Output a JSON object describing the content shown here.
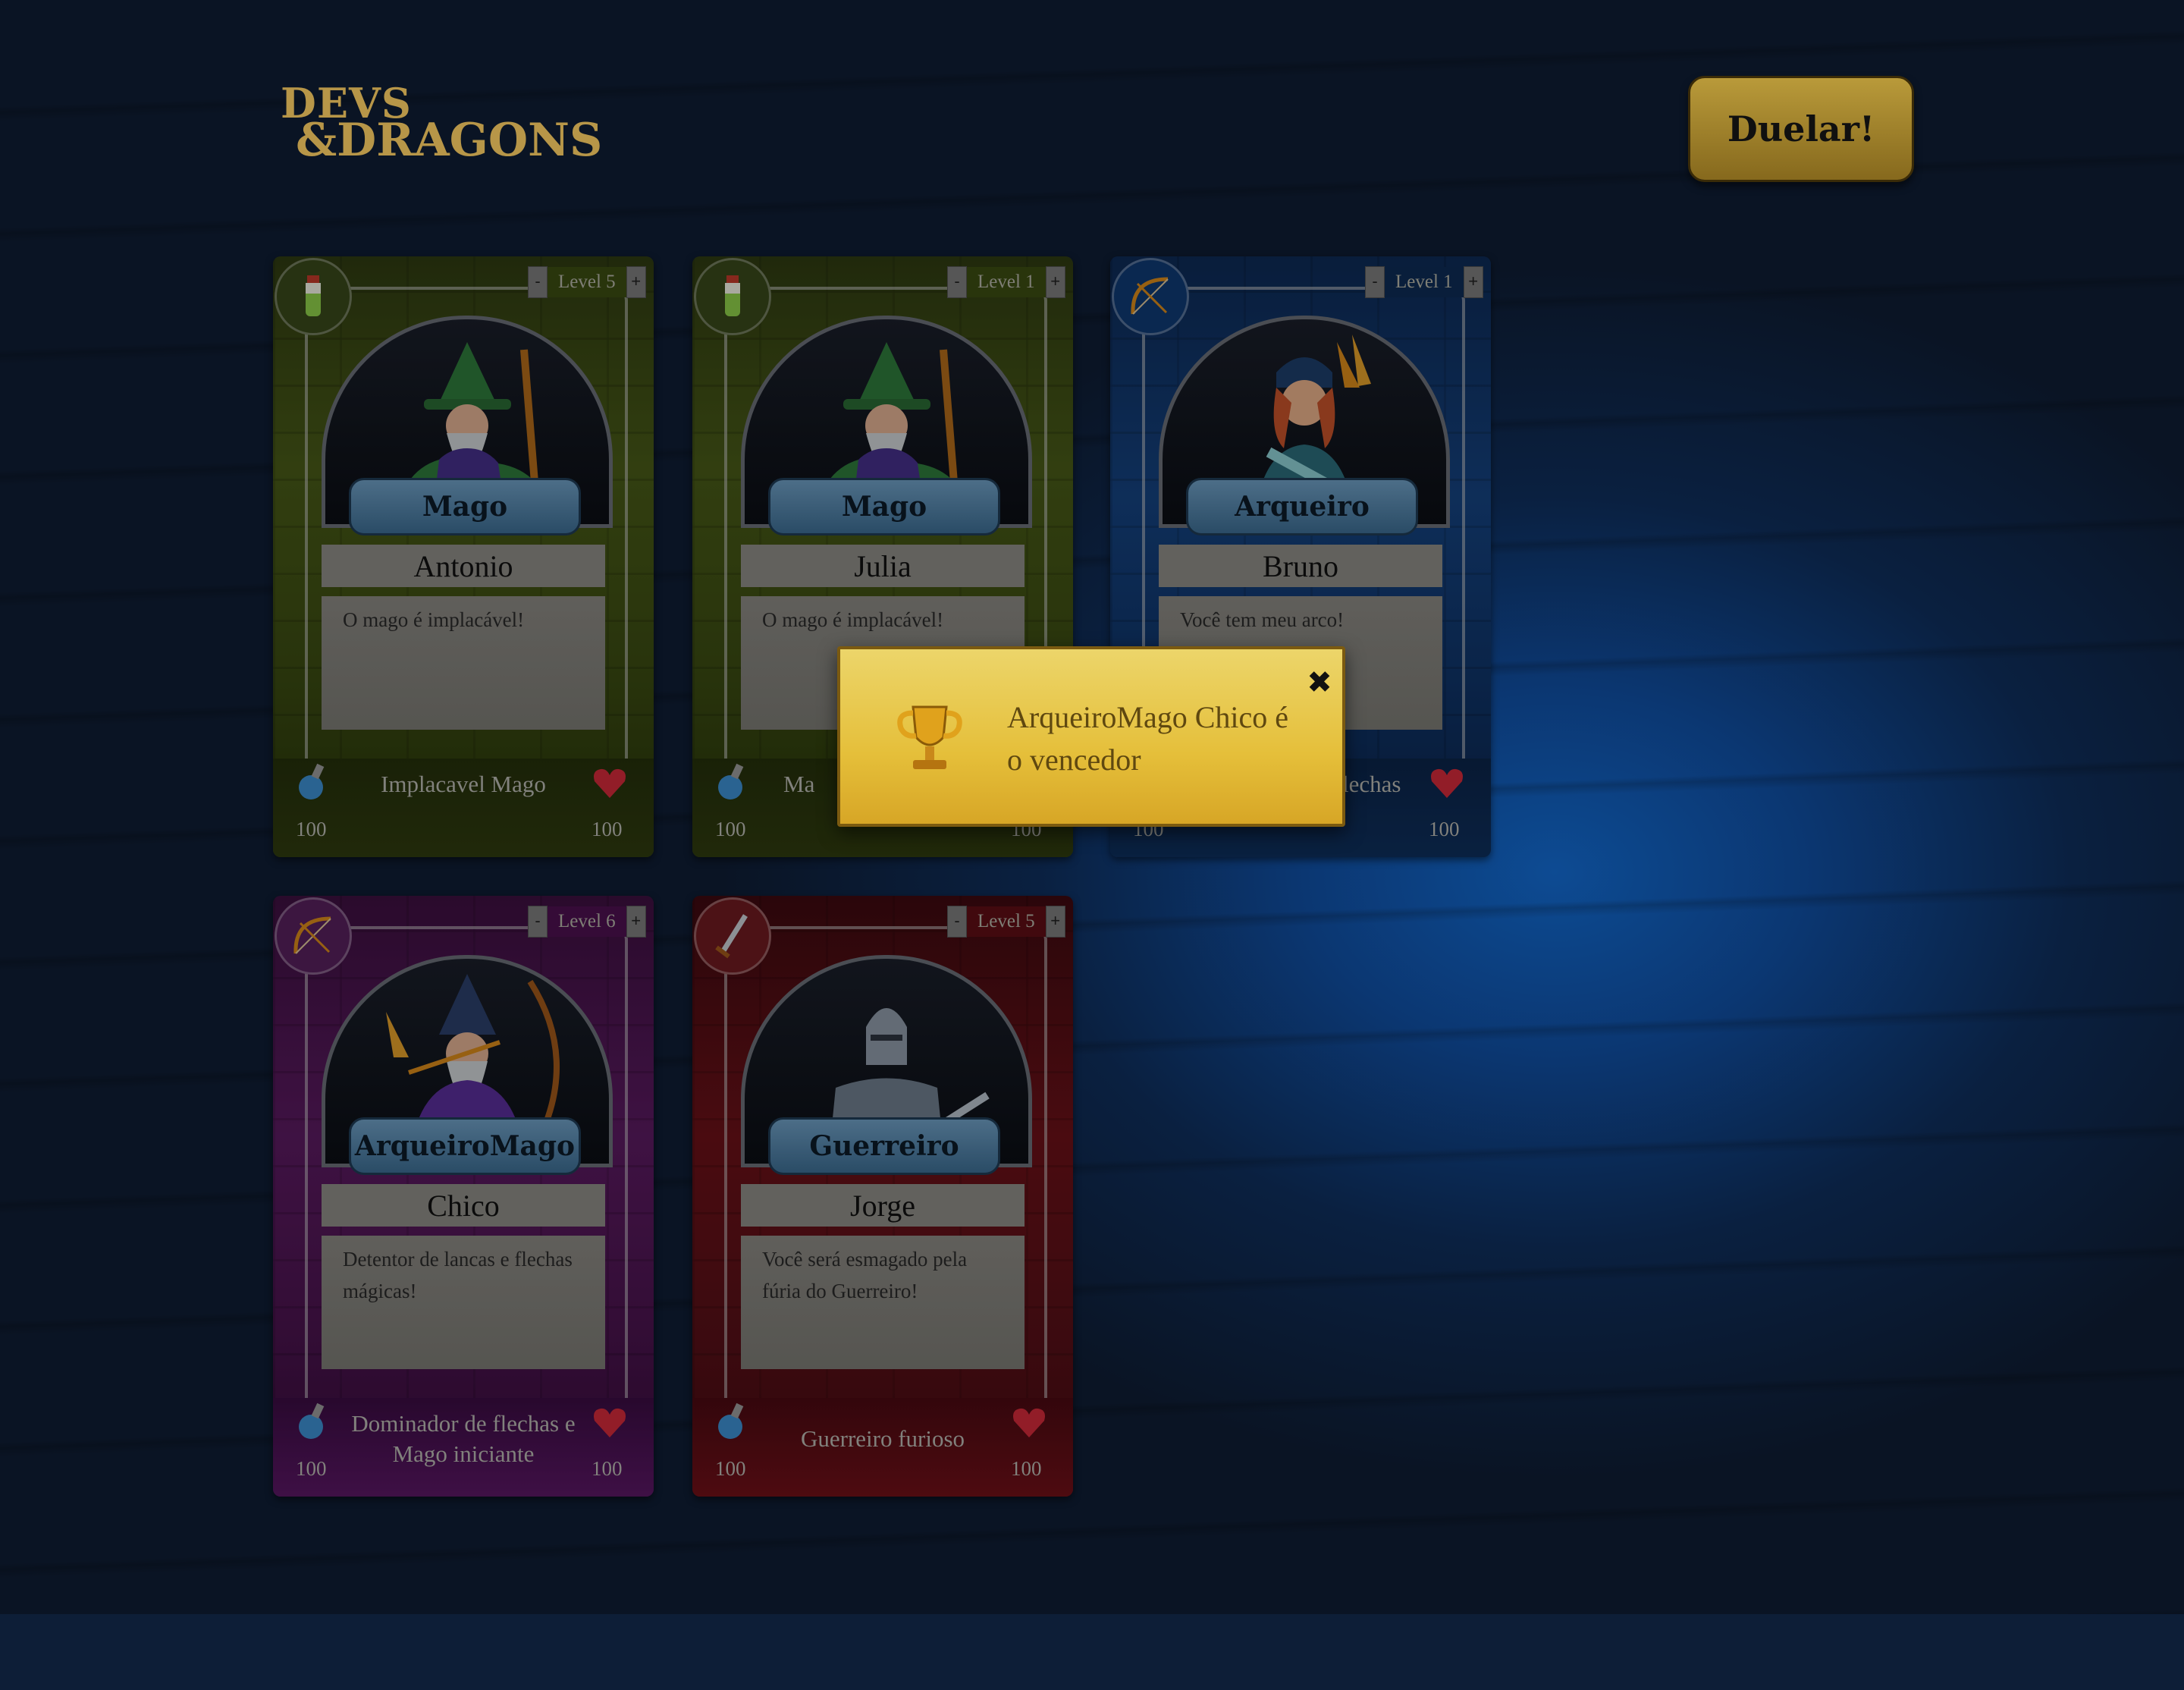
{
  "app": {
    "logo": {
      "line1": "DEVS",
      "line2": "&DRAGONS"
    },
    "duel_button": "Duelar!"
  },
  "cards": [
    {
      "theme": "green",
      "type_icon": "potion-icon",
      "level": "Level 5",
      "class": "Mago",
      "name": "Antonio",
      "description": "O mago é implacável!",
      "subtitle": "Implacavel Mago",
      "mana": "100",
      "hp": "100"
    },
    {
      "theme": "green",
      "type_icon": "potion-icon",
      "level": "Level 1",
      "class": "Mago",
      "name": "Julia",
      "description": "O mago é implacável!",
      "subtitle": "Ma",
      "mana": "100",
      "hp": "100"
    },
    {
      "theme": "blue",
      "type_icon": "bow-icon",
      "level": "Level 1",
      "class": "Arqueiro",
      "name": "Bruno",
      "description": "Você tem meu arco!",
      "subtitle": "lechas",
      "mana": "100",
      "hp": "100"
    },
    {
      "theme": "purple",
      "type_icon": "bow-icon",
      "level": "Level 6",
      "class": "ArqueiroMago",
      "name": "Chico",
      "description": "Detentor de lancas e flechas mágicas!",
      "subtitle": "Dominador de flechas e Mago iniciante",
      "mana": "100",
      "hp": "100"
    },
    {
      "theme": "red",
      "type_icon": "sword-icon",
      "level": "Level 5",
      "class": "Guerreiro",
      "name": "Jorge",
      "description": "Você será esmagado pela fúria do Guerreiro!",
      "subtitle": "Guerreiro furioso",
      "mana": "100",
      "hp": "100"
    }
  ],
  "level_controls": {
    "minus": "-",
    "plus": "+"
  },
  "modal": {
    "message": "ArqueiroMago Chico é o vencedor",
    "close": "✖",
    "icon": "trophy-icon"
  },
  "colors": {
    "background": "#0a1222",
    "duel_button": "#a88a2f",
    "modal": "#e6c03e"
  }
}
